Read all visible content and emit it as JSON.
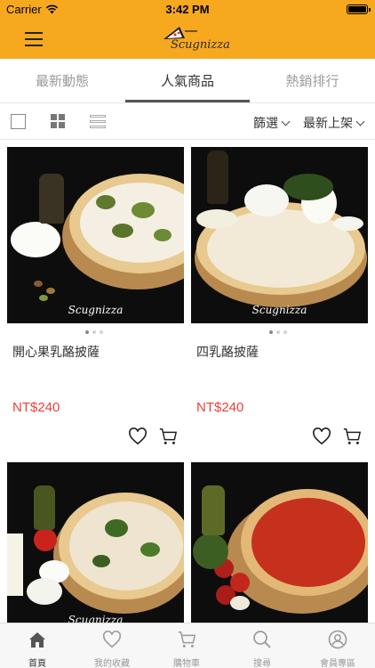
{
  "status": {
    "carrier": "Carrier",
    "time": "3:42 PM"
  },
  "header": {
    "logo_text": "Scugnizza"
  },
  "tabs": [
    {
      "label": "最新動態",
      "active": false
    },
    {
      "label": "人氣商品",
      "active": true
    },
    {
      "label": "熱銷排行",
      "active": false
    }
  ],
  "toolbar": {
    "filter_label": "篩選",
    "sort_label": "最新上架"
  },
  "products": [
    {
      "name": "開心果乳酪披薩",
      "price": "NT$240",
      "watermark": "Scugnizza"
    },
    {
      "name": "四乳酪披薩",
      "price": "NT$240",
      "watermark": "Scugnizza"
    },
    {
      "name": "",
      "price": "",
      "watermark": "Scugnizza"
    },
    {
      "name": "",
      "price": "",
      "watermark": ""
    }
  ],
  "bottom_nav": [
    {
      "label": "首頁",
      "icon": "home-icon",
      "active": true
    },
    {
      "label": "我的收藏",
      "icon": "heart-icon",
      "active": false
    },
    {
      "label": "購物車",
      "icon": "cart-icon",
      "active": false
    },
    {
      "label": "搜尋",
      "icon": "search-icon",
      "active": false
    },
    {
      "label": "會員專區",
      "icon": "user-icon",
      "active": false
    }
  ],
  "colors": {
    "brand": "#f6a81f",
    "price": "#ef3e36"
  }
}
